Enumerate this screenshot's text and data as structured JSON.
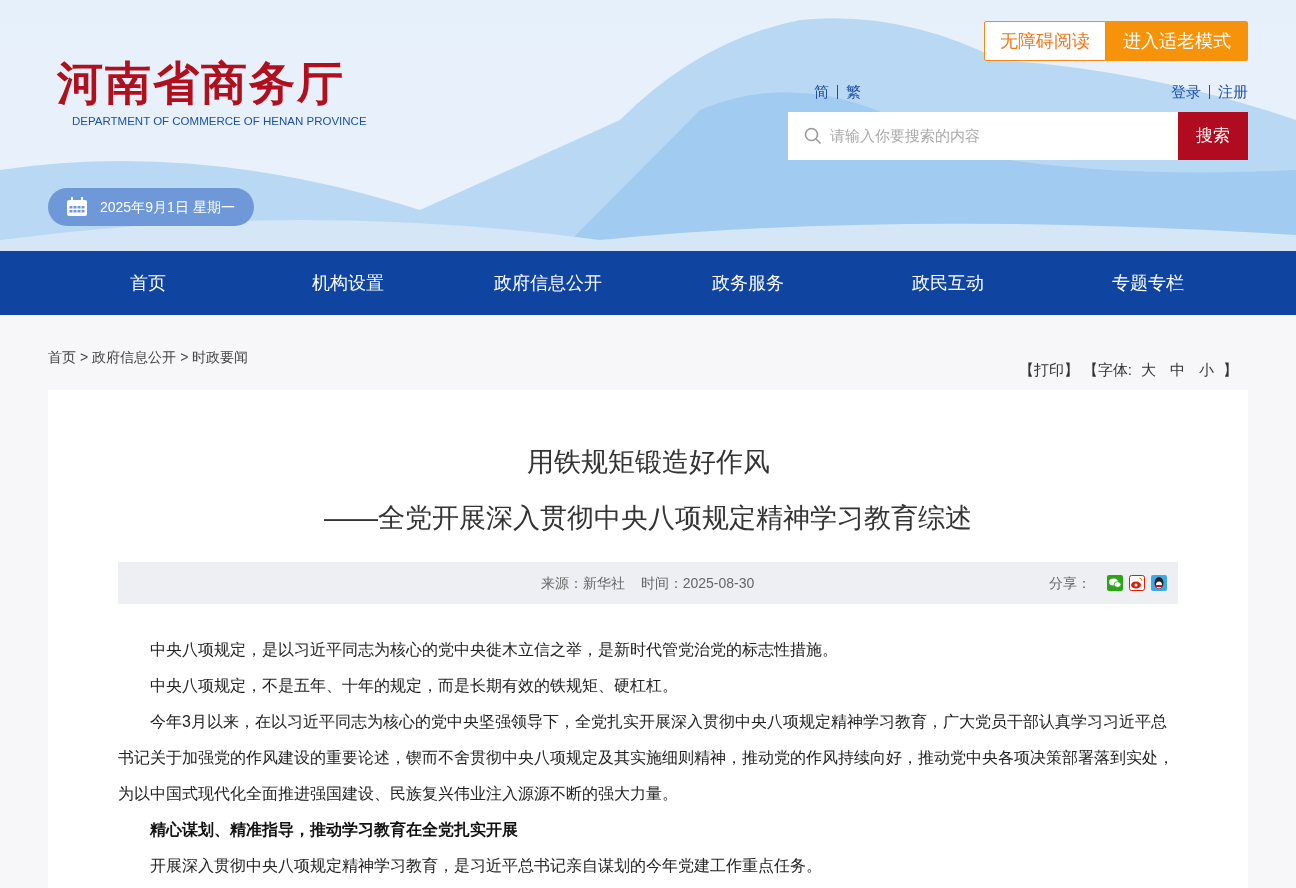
{
  "header": {
    "logo_title": "河南省商务厅",
    "logo_subtitle": "DEPARTMENT OF COMMERCE OF HENAN PROVINCE",
    "date": "2025年9月1日 星期一",
    "mode_buttons": [
      {
        "label": "无障碍阅读",
        "kind": "outline"
      },
      {
        "label": "进入适老模式",
        "kind": "filled"
      }
    ],
    "language_links": [
      "简",
      "繁"
    ],
    "account_links": [
      "登录",
      "注册"
    ],
    "search": {
      "placeholder": "请输入你要搜索的内容",
      "button": "搜索"
    }
  },
  "nav": {
    "items": [
      "首页",
      "机构设置",
      "政府信息公开",
      "政务服务",
      "政民互动",
      "专题专栏"
    ]
  },
  "breadcrumb": {
    "items": [
      "首页",
      "政府信息公开",
      "时政要闻"
    ],
    "separator": ">"
  },
  "tools": {
    "print": "【打印】",
    "font_label": "【字体:",
    "font_sizes": [
      "大",
      "中",
      "小"
    ],
    "font_close": "】"
  },
  "article": {
    "title": "用铁规矩锻造好作风",
    "subtitle": "——全党开展深入贯彻中央八项规定精神学习教育综述",
    "source": "来源：新华社",
    "time": "时间：2025-08-30",
    "share_label": "分享：",
    "paragraphs": [
      {
        "kind": "text",
        "text": "中央八项规定，是以习近平同志为核心的党中央徙木立信之举，是新时代管党治党的标志性措施。"
      },
      {
        "kind": "text",
        "text": "中央八项规定，不是五年、十年的规定，而是长期有效的铁规矩、硬杠杠。"
      },
      {
        "kind": "text",
        "text": "今年3月以来，在以习近平同志为核心的党中央坚强领导下，全党扎实开展深入贯彻中央八项规定精神学习教育，广大党员干部认真学习习近平总书记关于加强党的作风建设的重要论述，锲而不舍贯彻中央八项规定及其实施细则精神，推动党的作风持续向好，推动党中央各项决策部署落到实处，为以中国式现代化全面推进强国建设、民族复兴伟业注入源源不断的强大力量。"
      },
      {
        "kind": "heading",
        "text": "精心谋划、精准指导，推动学习教育在全党扎实开展"
      },
      {
        "kind": "text",
        "text": "开展深入贯彻中央八项规定精神学习教育，是习近平总书记亲自谋划的今年党建工作重点任务。"
      }
    ]
  }
}
